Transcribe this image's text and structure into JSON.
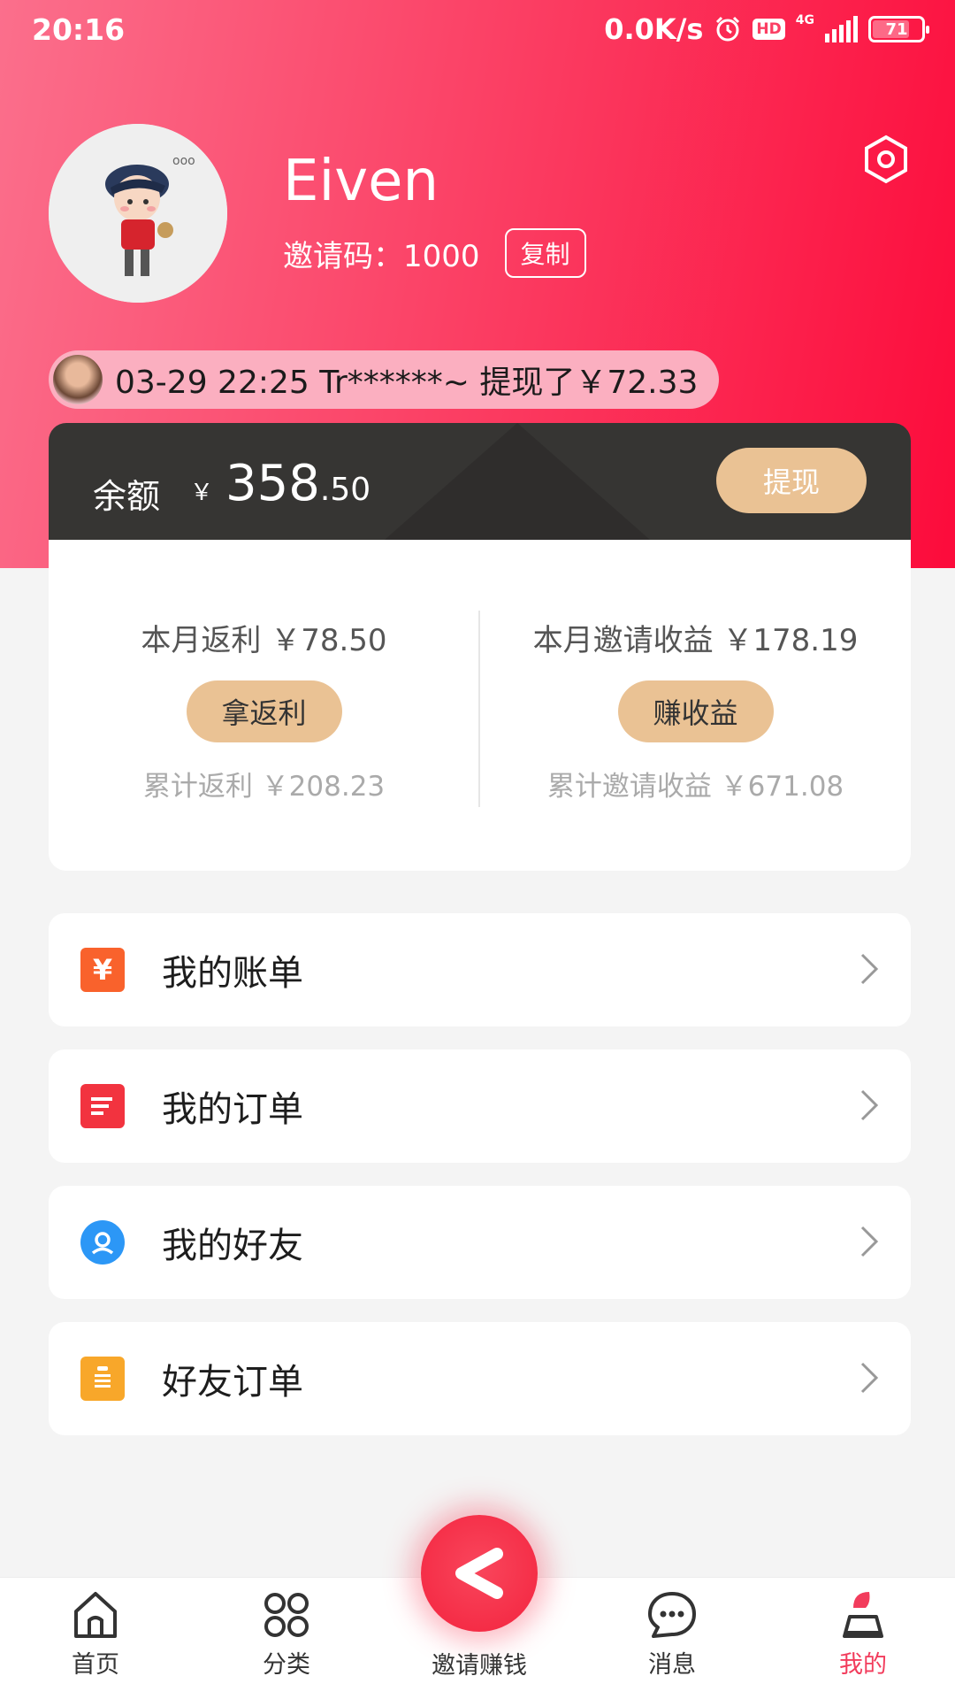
{
  "status_bar": {
    "time": "20:16",
    "speed": "0.0K/s",
    "hd": "HD",
    "network": "4G",
    "battery": "71"
  },
  "profile": {
    "username": "Eiven",
    "invite_code_label": "邀请码：1000",
    "copy_button": "复制"
  },
  "ticker": {
    "text": "03-29 22:25   Tr******~ 提现了￥72.33"
  },
  "balance": {
    "label": "余额",
    "currency": "￥",
    "integer": "358",
    "decimal": ".50",
    "withdraw_button": "提现"
  },
  "stats": {
    "left": {
      "headline": "本月返利 ￥78.50",
      "button": "拿返利",
      "footer": "累计返利 ￥208.23"
    },
    "right": {
      "headline": "本月邀请收益 ￥178.19",
      "button": "赚收益",
      "footer": "累计邀请收益 ￥671.08"
    }
  },
  "menu": [
    {
      "label": "我的账单",
      "icon": "yen-icon",
      "color": "#f9622c",
      "glyph": "¥"
    },
    {
      "label": "我的订单",
      "icon": "order-list-icon",
      "color": "#f2333f",
      "glyph": ""
    },
    {
      "label": "我的好友",
      "icon": "friend-icon",
      "color": "#2c97f6",
      "glyph": ""
    },
    {
      "label": "好友订单",
      "icon": "clipboard-icon",
      "color": "#f8a72a",
      "glyph": ""
    }
  ],
  "tabs": {
    "home": "首页",
    "category": "分类",
    "invite": "邀请赚钱",
    "messages": "消息",
    "mine": "我的"
  },
  "colors": {
    "brand": "#fb3e63",
    "gold": "#eac294",
    "dark_card": "#363533",
    "active_tab": "#f23c5c"
  }
}
